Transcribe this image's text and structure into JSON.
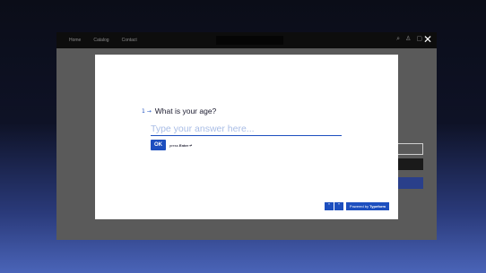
{
  "site": {
    "nav": [
      "Home",
      "Catalog",
      "Contact"
    ],
    "icons": [
      "search-icon",
      "user-icon",
      "cart-icon"
    ]
  },
  "modal": {
    "close_icon": "close-icon",
    "question_number_icon": "1 →",
    "question": "What is your age?",
    "answer_placeholder": "Type your answer here...",
    "ok_label": "OK",
    "hint_prefix": "press",
    "hint_key": "Enter ↵",
    "prev_icon": "chevron-up-icon",
    "next_icon": "chevron-down-icon",
    "powered_prefix": "Powered by",
    "powered_brand": "Typeform"
  },
  "colors": {
    "accent": "#1d4fbf",
    "placeholder": "#a9bde6"
  }
}
